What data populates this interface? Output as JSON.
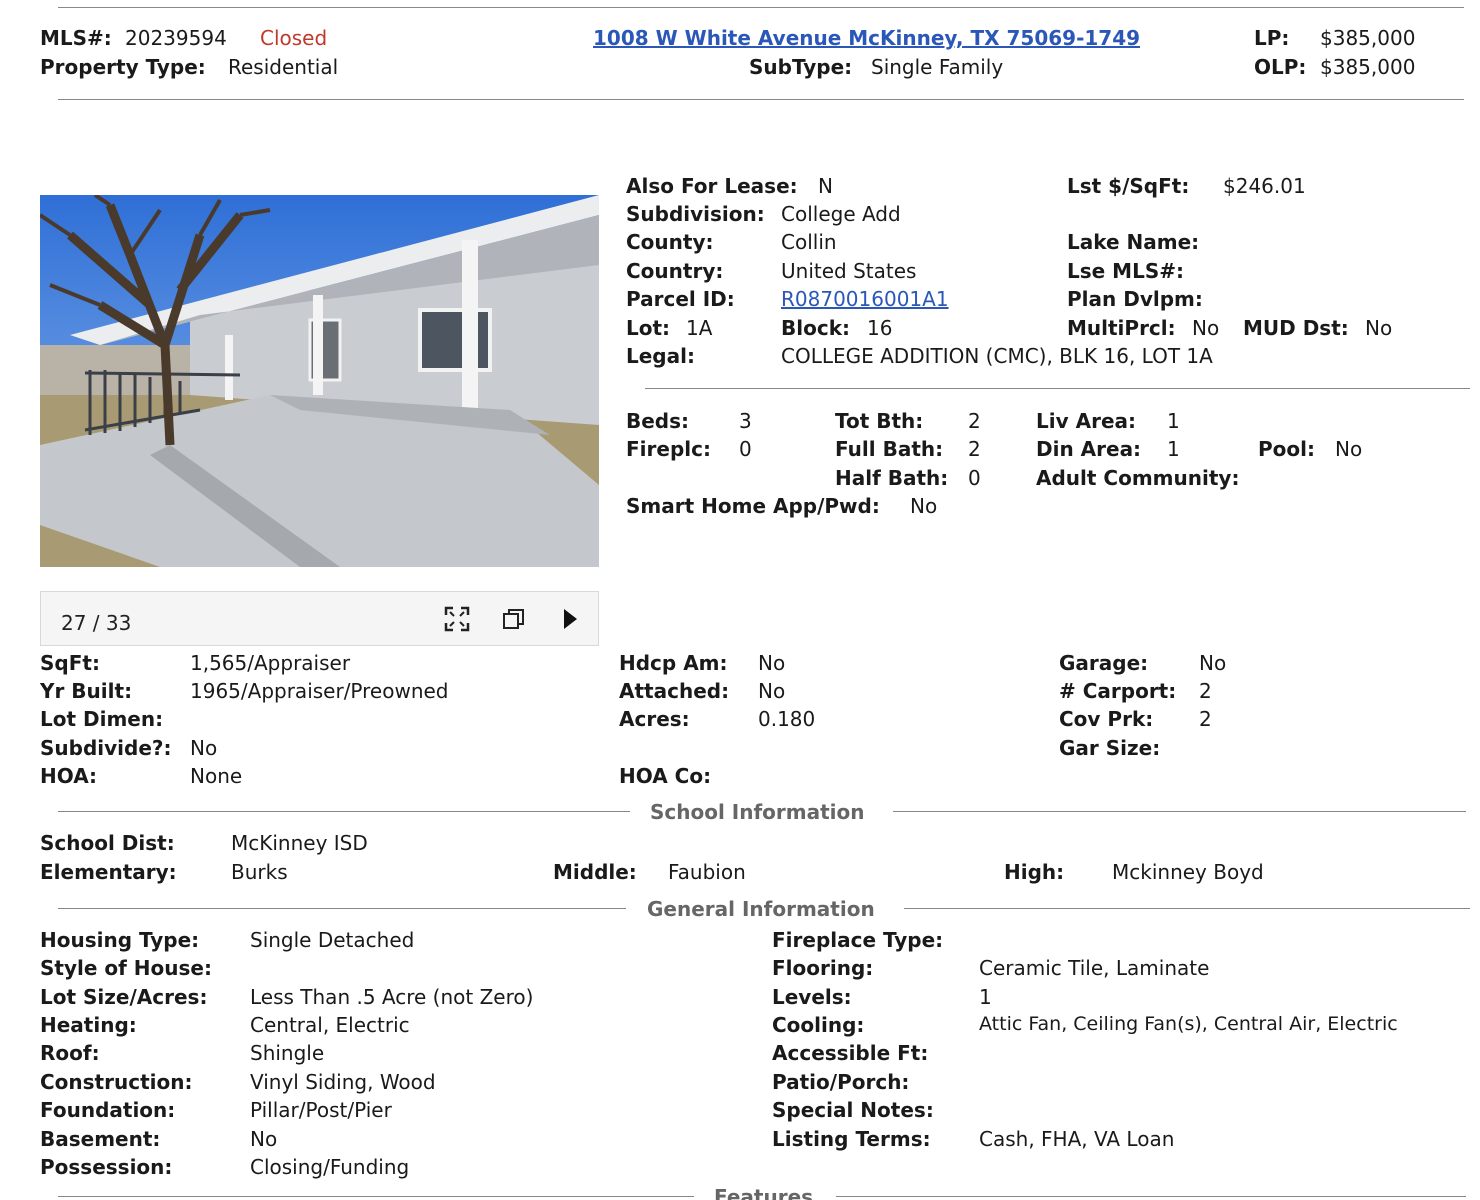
{
  "header": {
    "mls_label": "MLS#:",
    "mls_value": "20239594",
    "status": "Closed",
    "ptype_label": "Property Type:",
    "ptype_value": "Residential",
    "address": "1008 W White Avenue McKinney, TX 75069-1749",
    "subtype_label": "SubType:",
    "subtype_value": "Single Family",
    "lp_label": "LP:",
    "lp_value": "$385,000",
    "olp_label": "OLP:",
    "olp_value": "$385,000"
  },
  "photo": {
    "counter": "27 / 33",
    "icons": [
      "expand-icon",
      "popout-icon",
      "next-arrow-icon"
    ]
  },
  "summary": {
    "also_lease_label": "Also For Lease:",
    "also_lease_value": "N",
    "lst_sqft_label": "Lst $/SqFt:",
    "lst_sqft_value": "$246.01",
    "subdivision_label": "Subdivision:",
    "subdivision_value": "College Add",
    "county_label": "County:",
    "county_value": "Collin",
    "lake_label": "Lake Name:",
    "country_label": "Country:",
    "country_value": "United States",
    "lse_label": "Lse MLS#:",
    "parcel_label": "Parcel ID:",
    "parcel_value": "R0870016001A1",
    "plan_label": "Plan Dvlpm:",
    "lot_label": "Lot:",
    "lot_value": "1A",
    "block_label": "Block:",
    "block_value": "16",
    "multiprcl_label": "MultiPrcl:",
    "multiprcl_value": "No",
    "mud_label": "MUD Dst:",
    "mud_value": "No",
    "legal_label": "Legal:",
    "legal_value": "COLLEGE ADDITION (CMC), BLK 16, LOT 1A"
  },
  "rooms": {
    "beds_label": "Beds:",
    "beds_value": "3",
    "totbth_label": "Tot Bth:",
    "totbth_value": "2",
    "livarea_label": "Liv Area:",
    "livarea_value": "1",
    "fireplc_label": "Fireplc:",
    "fireplc_value": "0",
    "fullbath_label": "Full Bath:",
    "fullbath_value": "2",
    "dinarea_label": "Din Area:",
    "dinarea_value": "1",
    "pool_label": "Pool:",
    "pool_value": "No",
    "halfbath_label": "Half Bath:",
    "halfbath_value": "0",
    "adult_label": "Adult Community:",
    "smart_label": "Smart Home App/Pwd:",
    "smart_value": "No"
  },
  "details": {
    "sqft_label": "SqFt:",
    "sqft_value": "1,565/Appraiser",
    "yrbuilt_label": "Yr Built:",
    "yrbuilt_value": "1965/Appraiser/Preowned",
    "lotdimen_label": "Lot Dimen:",
    "subdivide_label": "Subdivide?:",
    "subdivide_value": "No",
    "hoa_label": "HOA:",
    "hoa_value": "None",
    "hdcp_label": "Hdcp Am:",
    "hdcp_value": "No",
    "attached_label": "Attached:",
    "attached_value": "No",
    "acres_label": "Acres:",
    "acres_value": "0.180",
    "hoaco_label": "HOA Co:",
    "garage_label": "Garage:",
    "garage_value": "No",
    "carport_label": "# Carport:",
    "carport_value": "2",
    "covprk_label": "Cov Prk:",
    "covprk_value": "2",
    "garsize_label": "Gar Size:"
  },
  "school": {
    "title": "School Information",
    "dist_label": "School Dist:",
    "dist_value": "McKinney ISD",
    "elem_label": "Elementary:",
    "elem_value": "Burks",
    "middle_label": "Middle:",
    "middle_value": "Faubion",
    "high_label": "High:",
    "high_value": "Mckinney Boyd"
  },
  "general": {
    "title": "General Information",
    "left": [
      {
        "label": "Housing Type:",
        "value": "Single Detached"
      },
      {
        "label": "Style of House:",
        "value": ""
      },
      {
        "label": "Lot Size/Acres:",
        "value": "Less Than .5 Acre (not Zero)"
      },
      {
        "label": "Heating:",
        "value": "Central, Electric"
      },
      {
        "label": "Roof:",
        "value": "Shingle"
      },
      {
        "label": "Construction:",
        "value": "Vinyl Siding, Wood"
      },
      {
        "label": "Foundation:",
        "value": "Pillar/Post/Pier"
      },
      {
        "label": "Basement:",
        "value": "No"
      },
      {
        "label": "Possession:",
        "value": "Closing/Funding"
      }
    ],
    "right": [
      {
        "label": "Fireplace Type:",
        "value": ""
      },
      {
        "label": "Flooring:",
        "value": "Ceramic Tile, Laminate"
      },
      {
        "label": "Levels:",
        "value": "1"
      },
      {
        "label": "Cooling:",
        "value": "Attic Fan, Ceiling Fan(s), Central Air, Electric"
      },
      {
        "label": "Accessible Ft:",
        "value": ""
      },
      {
        "label": "Patio/Porch:",
        "value": ""
      },
      {
        "label": "Special Notes:",
        "value": ""
      },
      {
        "label": "Listing Terms:",
        "value": "Cash, FHA, VA Loan"
      }
    ]
  },
  "features": {
    "title": "Features"
  }
}
